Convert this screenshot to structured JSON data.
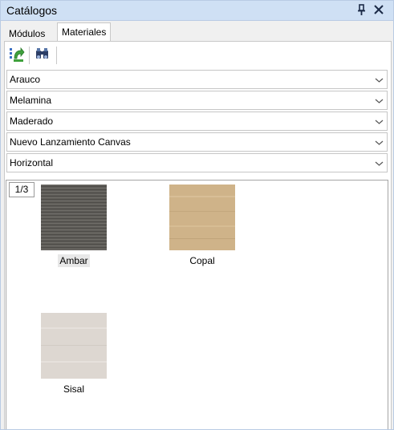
{
  "panel": {
    "title": "Catálogos",
    "pin_icon": "pin-icon",
    "close_icon": "close-icon"
  },
  "tabs": [
    {
      "label": "Módulos",
      "active": false
    },
    {
      "label": "Materiales",
      "active": true
    }
  ],
  "toolbar": {
    "buttons": [
      {
        "icon": "refresh-catalog-icon"
      },
      {
        "icon": "binoculars-find-icon"
      }
    ]
  },
  "filters": [
    {
      "value": "Arauco"
    },
    {
      "value": "Melamina"
    },
    {
      "value": "Maderado"
    },
    {
      "value": "Nuevo Lanzamiento Canvas"
    },
    {
      "value": "Horizontal"
    }
  ],
  "gallery": {
    "page": "1/3",
    "items": [
      {
        "label": "Ambar",
        "selected": true,
        "color": "#5e5c58"
      },
      {
        "label": "Copal",
        "selected": false,
        "color": "#cfb389"
      },
      {
        "label": "Sisal",
        "selected": false,
        "color": "#ddd7d1"
      }
    ]
  },
  "colors": {
    "titlebar_bg": "#cfe0f4",
    "panel_border": "#b9cbe4"
  }
}
